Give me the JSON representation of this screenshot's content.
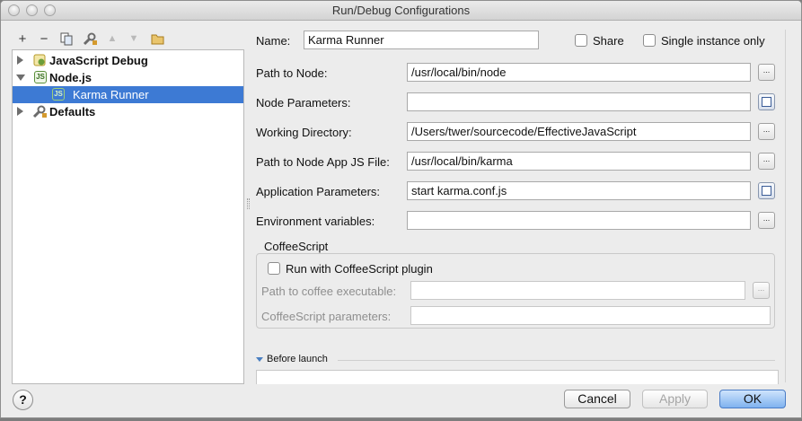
{
  "window": {
    "title": "Run/Debug Configurations"
  },
  "toolbar": {
    "add": "+",
    "remove": "−",
    "copy_icon": "copy-icon",
    "edit_defaults_icon": "wrench-icon",
    "move_up": "▲",
    "move_down": "▼",
    "folder_icon": "folder-icon"
  },
  "tree": {
    "items": [
      {
        "label": "JavaScript Debug",
        "expanded": false,
        "icon": "javascript-debug-icon"
      },
      {
        "label": "Node.js",
        "expanded": true,
        "icon": "nodejs-icon"
      },
      {
        "label": "Karma Runner",
        "selected": true,
        "icon": "nodejs-config-icon"
      },
      {
        "label": "Defaults",
        "expanded": false,
        "icon": "wrench-icon"
      }
    ]
  },
  "form": {
    "name_label": "Name:",
    "name_value": "Karma Runner",
    "share_label": "Share",
    "single_instance_label": "Single instance only",
    "rows": [
      {
        "label": "Path to Node:",
        "value": "/usr/local/bin/node",
        "button": "..."
      },
      {
        "label": "Node Parameters:",
        "value": "",
        "button": "expand"
      },
      {
        "label": "Working Directory:",
        "value": "/Users/twer/sourcecode/EffectiveJavaScript",
        "button": "..."
      },
      {
        "label": "Path to Node App JS File:",
        "value": "/usr/local/bin/karma",
        "button": "..."
      },
      {
        "label": "Application Parameters:",
        "value": "start karma.conf.js",
        "button": "expand"
      },
      {
        "label": "Environment variables:",
        "value": "",
        "button": "..."
      }
    ],
    "coffeescript": {
      "title": "CoffeeScript",
      "run_with_plugin_label": "Run with CoffeeScript plugin",
      "path_label": "Path to coffee executable:",
      "path_value": "",
      "path_button": "...",
      "params_label": "CoffeeScript parameters:",
      "params_value": ""
    },
    "before_launch_label": "Before launch"
  },
  "buttons": {
    "help": "?",
    "cancel": "Cancel",
    "apply": "Apply",
    "ok": "OK"
  }
}
